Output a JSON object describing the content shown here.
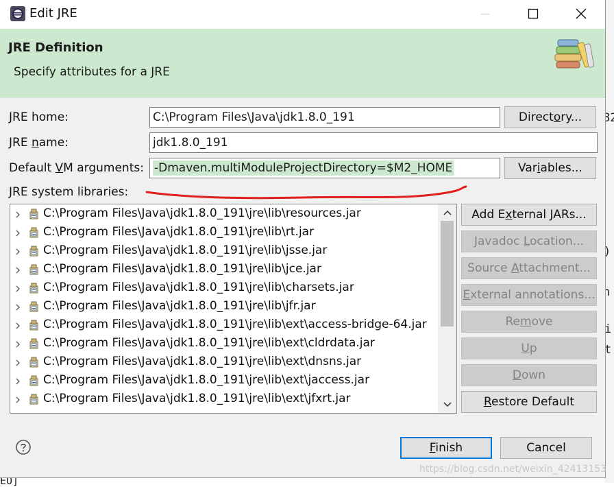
{
  "background": {
    "right_fragments": [
      "82",
      ")",
      "n",
      "i",
      "t"
    ],
    "bottom_fragment": "EO]"
  },
  "window": {
    "title": "Edit JRE",
    "icon": "eclipse-icon"
  },
  "header": {
    "title": "JRE Definition",
    "subtitle": "Specify attributes for a JRE",
    "icon": "books-icon"
  },
  "form": {
    "jre_home": {
      "label_pre": "",
      "label_key": "J",
      "label_post": "RE home:",
      "value": "C:\\Program Files\\Java\\jdk1.8.0_191"
    },
    "jre_name": {
      "label_pre": "JRE ",
      "label_key": "n",
      "label_post": "ame:",
      "value": "jdk1.8.0_191"
    },
    "vm_args": {
      "label_pre": "Default ",
      "label_key": "V",
      "label_post": "M arguments:",
      "value": "-Dmaven.multiModuleProjectDirectory=$M2_HOME"
    },
    "directory_button": {
      "pre": "Direct",
      "key": "o",
      "post": "ry..."
    },
    "variables_button": {
      "pre": "Var",
      "key": "i",
      "post": "ables..."
    },
    "libraries_label": "JRE system libraries:"
  },
  "libraries": [
    {
      "path": "C:\\Program Files\\Java\\jdk1.8.0_191\\jre\\lib\\resources.jar",
      "icon": "jar-icon"
    },
    {
      "path": "C:\\Program Files\\Java\\jdk1.8.0_191\\jre\\lib\\rt.jar",
      "icon": "jar-icon"
    },
    {
      "path": "C:\\Program Files\\Java\\jdk1.8.0_191\\jre\\lib\\jsse.jar",
      "icon": "jar-icon"
    },
    {
      "path": "C:\\Program Files\\Java\\jdk1.8.0_191\\jre\\lib\\jce.jar",
      "icon": "jar-icon"
    },
    {
      "path": "C:\\Program Files\\Java\\jdk1.8.0_191\\jre\\lib\\charsets.jar",
      "icon": "jar-icon"
    },
    {
      "path": "C:\\Program Files\\Java\\jdk1.8.0_191\\jre\\lib\\jfr.jar",
      "icon": "jar-icon"
    },
    {
      "path": "C:\\Program Files\\Java\\jdk1.8.0_191\\jre\\lib\\ext\\access-bridge-64.jar",
      "icon": "jar-icon"
    },
    {
      "path": "C:\\Program Files\\Java\\jdk1.8.0_191\\jre\\lib\\ext\\cldrdata.jar",
      "icon": "jar-icon"
    },
    {
      "path": "C:\\Program Files\\Java\\jdk1.8.0_191\\jre\\lib\\ext\\dnsns.jar",
      "icon": "jar-icon"
    },
    {
      "path": "C:\\Program Files\\Java\\jdk1.8.0_191\\jre\\lib\\ext\\jaccess.jar",
      "icon": "jar-icon"
    },
    {
      "path": "C:\\Program Files\\Java\\jdk1.8.0_191\\jre\\lib\\ext\\jfxrt.jar",
      "icon": "jar-icon"
    }
  ],
  "side_buttons": {
    "add_external_jars": {
      "pre": "Add E",
      "key": "x",
      "post": "ternal JARs..."
    },
    "javadoc_location": {
      "pre": "Javadoc ",
      "key": "L",
      "post": "ocation..."
    },
    "source_attachment": {
      "pre": "Source ",
      "key": "A",
      "post": "ttachment..."
    },
    "external_annotations": {
      "pre": "",
      "key": "E",
      "post": "xternal annotations..."
    },
    "remove": {
      "pre": "Re",
      "key": "m",
      "post": "ove"
    },
    "up": {
      "pre": "",
      "key": "U",
      "post": "p"
    },
    "down": {
      "pre": "",
      "key": "D",
      "post": "own"
    },
    "restore_default": {
      "pre": "",
      "key": "R",
      "post": "estore Default"
    }
  },
  "footer": {
    "finish": {
      "pre": "",
      "key": "F",
      "post": "inish"
    },
    "cancel": "Cancel",
    "watermark": "https://blog.csdn.net/weixin_42413153"
  },
  "colors": {
    "header_bg": "#cce8cf",
    "annotation_stroke": "#e0201e",
    "primary_border": "#0078d7"
  }
}
